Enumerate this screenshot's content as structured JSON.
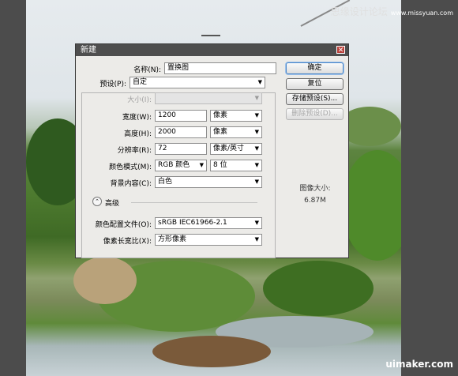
{
  "watermark": {
    "top_text": "思缘设计论坛",
    "top_site": "www.missyuan.com",
    "bottom_text": "uimaker.com"
  },
  "dialog": {
    "title": "新建",
    "name": {
      "label": "名称(N):",
      "value": "置换图"
    },
    "preset": {
      "label": "预设(P):",
      "value": "自定"
    },
    "size": {
      "label": "大小(I):",
      "value": ""
    },
    "width": {
      "label": "宽度(W):",
      "value": "1200",
      "unit": "像素"
    },
    "height": {
      "label": "高度(H):",
      "value": "2000",
      "unit": "像素"
    },
    "resolution": {
      "label": "分辨率(R):",
      "value": "72",
      "unit": "像素/英寸"
    },
    "color_mode": {
      "label": "颜色模式(M):",
      "value": "RGB 颜色",
      "bits": "8 位"
    },
    "background": {
      "label": "背景内容(C):",
      "value": "白色"
    },
    "advanced": {
      "label": "高级"
    },
    "color_profile": {
      "label": "颜色配置文件(O):",
      "value": "sRGB IEC61966-2.1"
    },
    "pixel_aspect": {
      "label": "像素长宽比(X):",
      "value": "方形像素"
    },
    "buttons": {
      "ok": "确定",
      "reset": "复位",
      "save_preset": "存储预设(S)...",
      "delete_preset": "删除预设(D)..."
    },
    "image_size": {
      "title": "图像大小:",
      "value": "6.87M"
    }
  },
  "colors": {
    "titlebar": "#4e4e4e",
    "dialog_bg": "#ecebe8",
    "accent": "#4a86c8"
  }
}
